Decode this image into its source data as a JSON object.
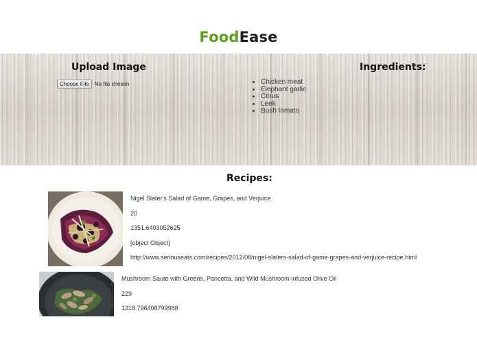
{
  "header": {
    "brand_part1": "Food",
    "brand_part2": "Ease"
  },
  "upload": {
    "heading": "Upload Image",
    "button_label": "Choose File",
    "file_status": "No file chosen"
  },
  "ingredients": {
    "heading": "Ingredients:",
    "items": [
      "Chicken meat",
      "Elephant garlic",
      "Citrus",
      "Leek",
      "Bush tomato"
    ]
  },
  "recipes": {
    "heading": "Recipes:",
    "items": [
      {
        "title": "Nigel Slater's Salad of Game, Grapes, and Verjuice",
        "count": "20",
        "calories": "1351.6403052625",
        "object": "[object Object]",
        "url": "http://www.seriouseats.com/recipes/2012/08/nigel-slaters-salad-of-game-grapes-and-verjuice-recipe.html"
      },
      {
        "title": "Mushroom Saute with Greens, Pancetta, and Wild Mushroom-infused Olive Oil",
        "count": "229",
        "calories": "1218.796408799988"
      }
    ]
  },
  "colors": {
    "brand_green": "#5a9e1b",
    "brand_dark": "#1e1e1e"
  }
}
